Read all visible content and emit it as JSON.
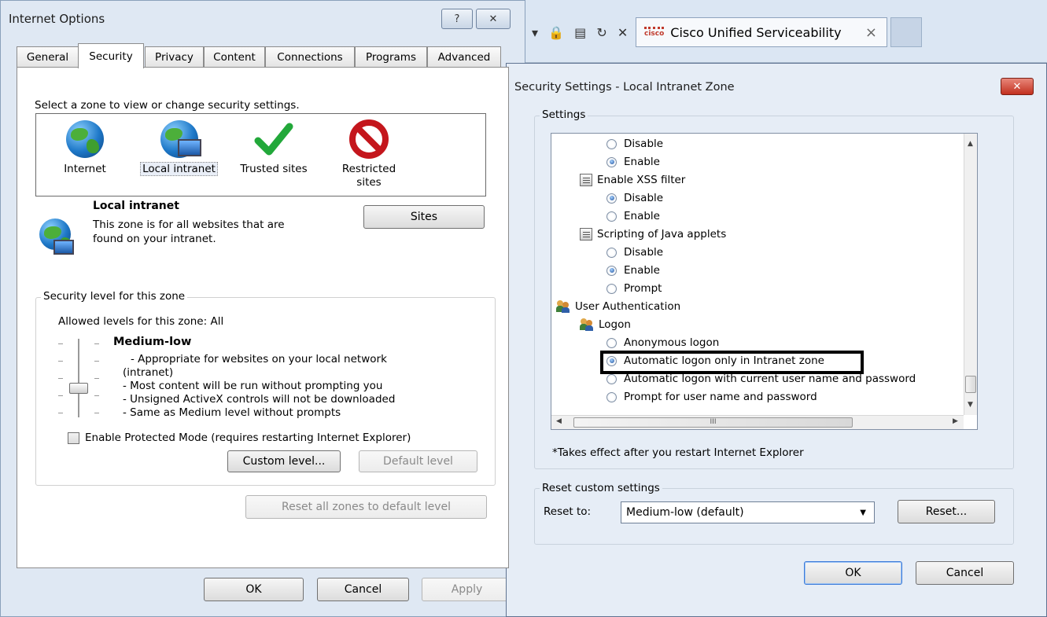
{
  "internet_options": {
    "title": "Internet Options",
    "help_label": "?",
    "close_label": "✕",
    "tabs": [
      "General",
      "Security",
      "Privacy",
      "Content",
      "Connections",
      "Programs",
      "Advanced"
    ],
    "active_tab": "Security",
    "zone_prompt": "Select a zone to view or change security settings.",
    "zones": [
      {
        "label": "Internet"
      },
      {
        "label": "Local intranet"
      },
      {
        "label": "Trusted sites"
      },
      {
        "label": "Restricted sites"
      }
    ],
    "selected_zone": {
      "name": "Local intranet",
      "description_line1": "This zone is for all websites that are",
      "description_line2": "found on your intranet."
    },
    "sites_button": "Sites",
    "security_level": {
      "legend": "Security level for this zone",
      "allowed": "Allowed levels for this zone: All",
      "level_name": "Medium-low",
      "bullets": [
        "- Appropriate for websites on your local network",
        "(intranet)",
        "- Most content will be run without prompting you",
        "- Unsigned ActiveX controls will not be downloaded",
        "- Same as Medium level without prompts"
      ]
    },
    "protected_mode_label": "Enable Protected Mode (requires restarting Internet Explorer)",
    "protected_mode_checked": false,
    "custom_level_button": "Custom level...",
    "default_level_button": "Default level",
    "reset_all_button": "Reset all zones to default level",
    "ok_button": "OK",
    "cancel_button": "Cancel",
    "apply_button": "Apply"
  },
  "browser": {
    "toolbar_icons": "▾ 🔒 ▤ ↻ ✕",
    "tab_title": "Cisco Unified Serviceability",
    "tab_close": "×",
    "tab_logo_text": "cisco"
  },
  "security_settings": {
    "title": "Security Settings - Local Intranet Zone",
    "close_label": "✕",
    "settings_legend": "Settings",
    "items": [
      {
        "kind": "radio",
        "label": "Disable",
        "checked": false
      },
      {
        "kind": "radio",
        "label": "Enable",
        "checked": true
      },
      {
        "kind": "group",
        "label": "Enable XSS filter"
      },
      {
        "kind": "radio",
        "label": "Disable",
        "checked": true
      },
      {
        "kind": "radio",
        "label": "Enable",
        "checked": false
      },
      {
        "kind": "group",
        "label": "Scripting of Java applets"
      },
      {
        "kind": "radio",
        "label": "Disable",
        "checked": false
      },
      {
        "kind": "radio",
        "label": "Enable",
        "checked": true
      },
      {
        "kind": "radio",
        "label": "Prompt",
        "checked": false
      },
      {
        "kind": "category",
        "label": "User Authentication"
      },
      {
        "kind": "subcategory",
        "label": "Logon"
      },
      {
        "kind": "radio",
        "label": "Anonymous logon",
        "checked": false
      },
      {
        "kind": "radio",
        "label": "Automatic logon only in Intranet zone",
        "checked": true
      },
      {
        "kind": "radio",
        "label": "Automatic logon with current user name and password",
        "checked": false
      },
      {
        "kind": "radio",
        "label": "Prompt for user name and password",
        "checked": false
      }
    ],
    "hscroll_thumb_label": "III",
    "restart_note": "*Takes effect after you restart Internet Explorer",
    "reset_legend": "Reset custom settings",
    "reset_to_label": "Reset to:",
    "reset_to_value": "Medium-low (default)",
    "reset_button": "Reset...",
    "ok_button": "OK",
    "cancel_button": "Cancel"
  }
}
